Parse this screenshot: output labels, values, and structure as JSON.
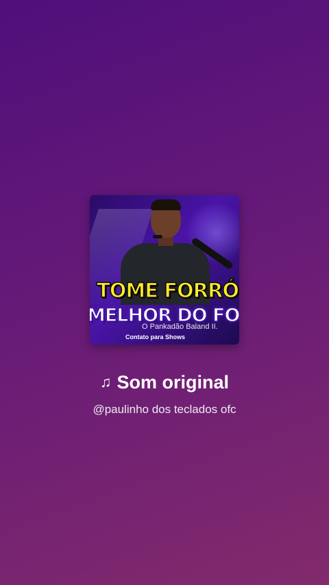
{
  "sound": {
    "title": "Som original",
    "author": "@paulinho dos teclados ofc",
    "note_icon": "music-note-icon",
    "cover": {
      "headline": "TOME FORRÓ",
      "subheadline": "MELHOR DO FOR",
      "byline": "O Pankadão Baland",
      "byline_tail": "II.",
      "contact": "Contato para Shows"
    }
  },
  "colors": {
    "background_top": "#4f0f7a",
    "background_bottom": "#822a6b",
    "headline": "#ffea2a",
    "text": "#ffffff"
  }
}
